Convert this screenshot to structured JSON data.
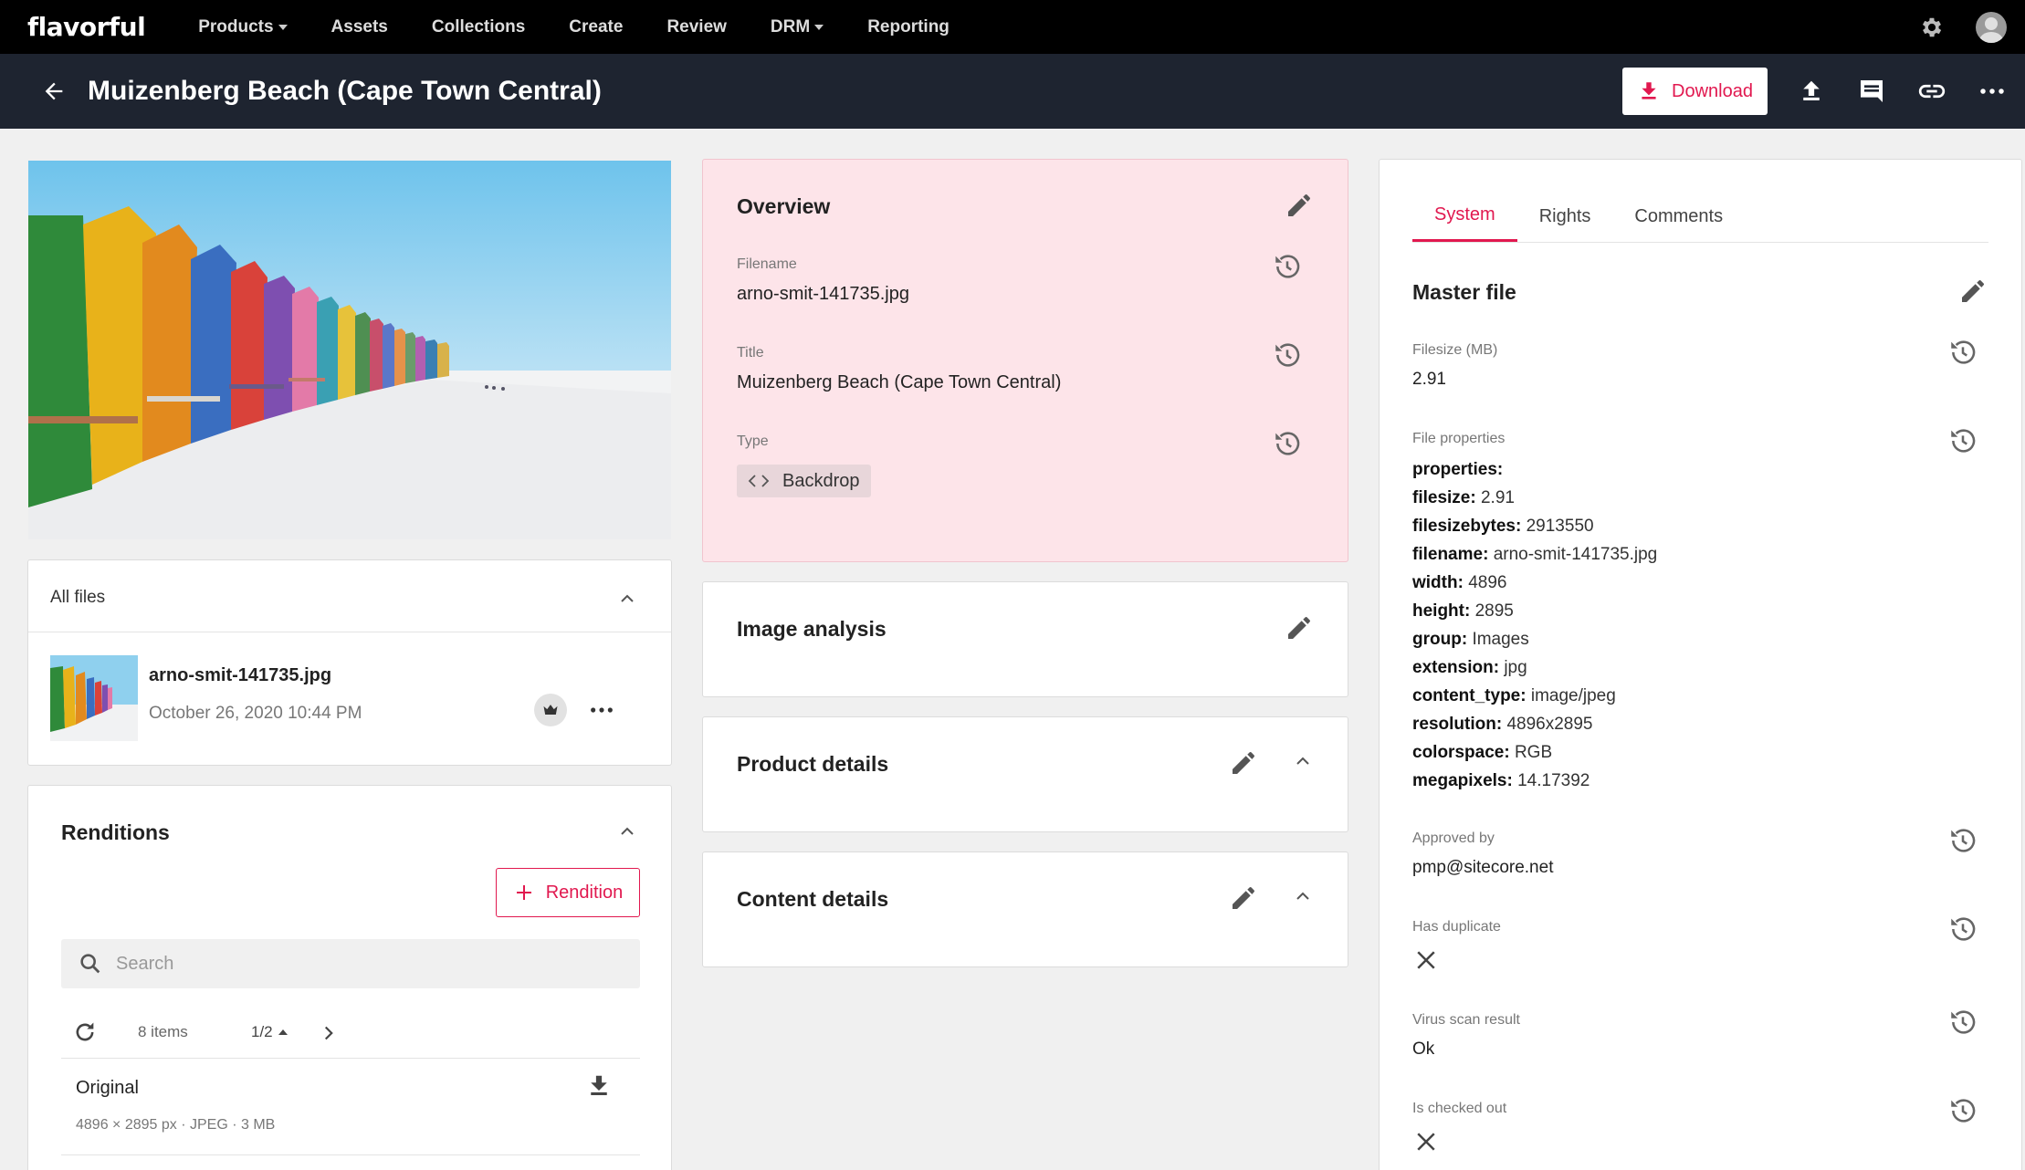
{
  "app": {
    "logo": "flavorful"
  },
  "nav": {
    "items": [
      {
        "label": "Products",
        "has_caret": true
      },
      {
        "label": "Assets",
        "has_caret": false
      },
      {
        "label": "Collections",
        "has_caret": false
      },
      {
        "label": "Create",
        "has_caret": false
      },
      {
        "label": "Review",
        "has_caret": false
      },
      {
        "label": "DRM",
        "has_caret": true
      },
      {
        "label": "Reporting",
        "has_caret": false
      }
    ]
  },
  "header": {
    "title": "Muizenberg Beach (Cape Town Central)",
    "download_label": "Download"
  },
  "all_files": {
    "title": "All files",
    "file": {
      "name": "arno-smit-141735.jpg",
      "date": "October 26, 2020 10:44 PM"
    }
  },
  "renditions": {
    "title": "Renditions",
    "add_label": "Rendition",
    "search_placeholder": "Search",
    "count": "8 items",
    "page": "1/2",
    "items": [
      {
        "name": "Original",
        "meta": "4896 × 2895 px  ·  JPEG  ·  3 MB"
      }
    ]
  },
  "overview": {
    "title": "Overview",
    "fields": {
      "filename_label": "Filename",
      "filename": "arno-smit-141735.jpg",
      "title_label": "Title",
      "title": "Muizenberg Beach (Cape Town Central)",
      "type_label": "Type",
      "type": "Backdrop"
    }
  },
  "sections": {
    "image_analysis": "Image analysis",
    "product_details": "Product details",
    "content_details": "Content details"
  },
  "right_panel": {
    "tabs": [
      "System",
      "Rights",
      "Comments"
    ],
    "active_tab": "System",
    "master_file": "Master file",
    "filesize_label": "Filesize (MB)",
    "filesize": "2.91",
    "file_properties_label": "File properties",
    "properties_header": "properties:",
    "properties": [
      {
        "key": "filesize:",
        "value": "2.91"
      },
      {
        "key": "filesizebytes:",
        "value": "2913550"
      },
      {
        "key": "filename:",
        "value": "arno-smit-141735.jpg"
      },
      {
        "key": "width:",
        "value": "4896"
      },
      {
        "key": "height:",
        "value": "2895"
      },
      {
        "key": "group:",
        "value": "Images"
      },
      {
        "key": "extension:",
        "value": "jpg"
      },
      {
        "key": "content_type:",
        "value": "image/jpeg"
      },
      {
        "key": "resolution:",
        "value": "4896x2895"
      },
      {
        "key": "colorspace:",
        "value": "RGB"
      },
      {
        "key": "megapixels:",
        "value": "14.17392"
      }
    ],
    "approved_by_label": "Approved by",
    "approved_by": "pmp@sitecore.net",
    "has_duplicate_label": "Has duplicate",
    "virus_scan_label": "Virus scan result",
    "virus_scan": "Ok",
    "checked_out_label": "Is checked out"
  },
  "colors": {
    "accent": "#e1184f",
    "overview_bg": "#fde4e9",
    "topbar": "#000000",
    "subheader": "#1e2430"
  }
}
